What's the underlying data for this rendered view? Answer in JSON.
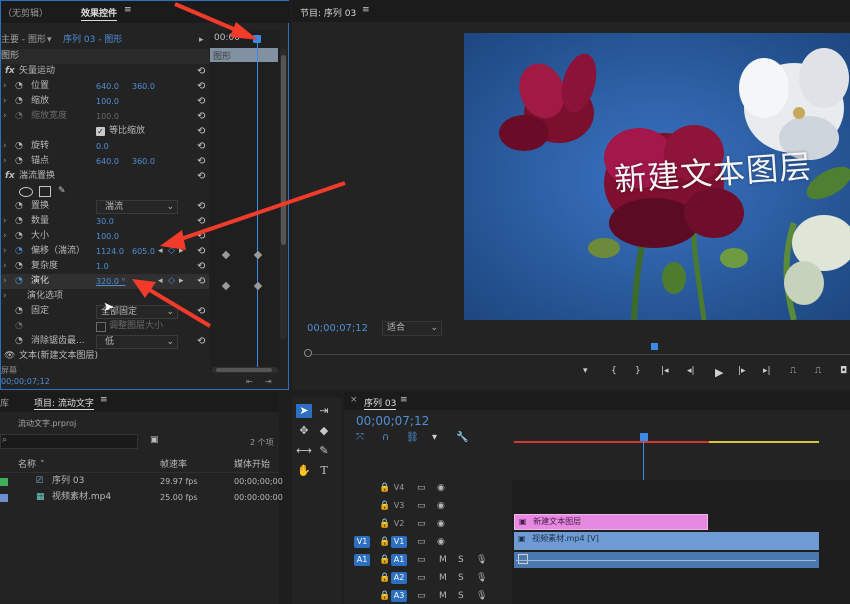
{
  "source_panel": {
    "tab_source": "（无剪辑）",
    "tab_effect": "效果控件",
    "menu": "≡"
  },
  "effect_controls": {
    "header_master": "主要 - 图形",
    "header_seq": "序列 03 - 图形",
    "time": "00:00",
    "clip_label": "图形",
    "section_graphic": "图形",
    "fx_motion": "矢量运动",
    "position_label": "位置",
    "position_x": "640.0",
    "position_y": "360.0",
    "scale_label": "缩放",
    "scale_value": "100.0",
    "scale_width_label": "缩放宽度",
    "scale_width_value": "100.0",
    "uniform_scale_label": "等比缩放",
    "rotation_label": "旋转",
    "rotation_value": "0.0",
    "anchor_label": "锚点",
    "anchor_x": "640.0",
    "anchor_y": "360.0",
    "fx_turbulent": "湍流置换",
    "displace_label": "置换",
    "displace_value": "湍流",
    "amount_label": "数量",
    "amount_value": "30.0",
    "size_label": "大小",
    "size_value": "100.0",
    "offset_label": "偏移（湍流）",
    "offset_x": "1124.0",
    "offset_y": "605.0",
    "complexity_label": "复杂度",
    "complexity_value": "1.0",
    "evolution_label": "演化",
    "evolution_value": "320.0 °",
    "evolution_options_label": "演化选项",
    "pinning_label": "固定",
    "pinning_value": "全部固定",
    "resize_layer_label": "调整图层大小",
    "antialias_label": "消除锯齿最...",
    "antialias_value": "低",
    "text_layer_label": "文本(新建文本图层)",
    "footer_left": "屏幕",
    "current_time": "00;00;07;12"
  },
  "program_monitor": {
    "tab": "节目: 序列 03",
    "menu": "≡",
    "overlay_text": "新建文本图层",
    "timecode": "00;00;07;12",
    "fit_label": "适合",
    "buttons": [
      "◆",
      "{",
      "}",
      "|◀◀",
      "◀|",
      "▶",
      "|▶",
      "▶▶|"
    ]
  },
  "project_panel": {
    "tab_left": "库",
    "tab": "项目: 流动文字",
    "menu": "≡",
    "file": "流动文字.prproj",
    "item_count": "2 个项",
    "col_name": "名称",
    "col_fps": "帧速率",
    "col_start": "媒体开始",
    "rows": [
      {
        "name": "序列 03",
        "fps": "29.97 fps",
        "start": "00;00;00;00",
        "color": "#3fae5a"
      },
      {
        "name": "视频素材.mp4",
        "fps": "25.00 fps",
        "start": "00:00:00:00",
        "color": "#6b8fd0"
      }
    ]
  },
  "timeline": {
    "tab": "序列 03",
    "menu": "≡",
    "timecode": "00;00;07;12",
    "tracks_video": [
      "V4",
      "V3",
      "V2",
      "V1"
    ],
    "tracks_audio": [
      "A1",
      "A2",
      "A3"
    ],
    "src_v1": "V1",
    "src_a1": "A1",
    "clip_text": "新建文本图层",
    "clip_video": "视频素材.mp4 [V]",
    "colors": {
      "text_clip": "#e58ae0",
      "video_clip": "#6f9bd4",
      "audio_clip": "#4c79ad",
      "playhead": "#2f7de0"
    }
  }
}
